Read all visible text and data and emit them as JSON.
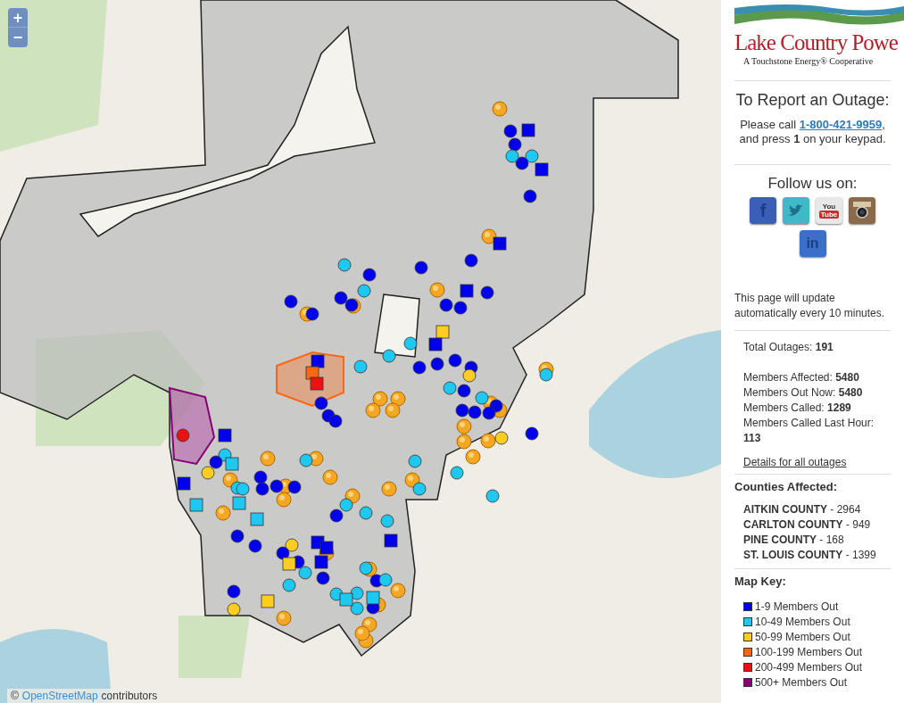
{
  "map": {
    "zoom_in": "+",
    "zoom_out": "−",
    "attribution": {
      "prefix": "©",
      "link": "OpenStreetMap",
      "suffix": "contributors"
    }
  },
  "sidebar": {
    "logo": {
      "name": "Lake Country Powe",
      "tagline": "A Touchstone Energy® Cooperative"
    },
    "report": {
      "title": "To Report an Outage:",
      "before": "Please call",
      "phone": "1-800-421-9959",
      "after": ", and press **1** on your keypad."
    },
    "follow": {
      "title": "Follow us on:",
      "socials": [
        {
          "kind": "facebook",
          "glyph": "f"
        },
        {
          "kind": "twitter"
        },
        {
          "kind": "youtube",
          "glyph": "You",
          "glyph2": "Tube"
        },
        {
          "kind": "instagram"
        },
        {
          "kind": "linkedin",
          "glyph": "in"
        }
      ]
    },
    "update_note": "This page will update automatically every 10 minutes.",
    "stats": {
      "total": {
        "label": "Total Outages:",
        "value": "191"
      },
      "items": [
        {
          "label": "Members Affected:",
          "value": "5480"
        },
        {
          "label": "Members Out Now:",
          "value": "5480"
        },
        {
          "label": "Members Called:",
          "value": "1289"
        },
        {
          "label": "Members Called Last Hour:",
          "value": "113"
        }
      ],
      "details_link": "Details for all outages"
    },
    "counties": {
      "title": "Counties Affected:",
      "items": [
        {
          "name": "AITKIN COUNTY",
          "count": "- 2964"
        },
        {
          "name": "CARLTON COUNTY",
          "count": "- 949"
        },
        {
          "name": "PINE COUNTY",
          "count": "- 168"
        },
        {
          "name": "ST. LOUIS COUNTY",
          "count": "- 1399"
        }
      ]
    },
    "map_key": {
      "title": "Map Key:",
      "items": [
        {
          "label": "1-9 Members Out",
          "color": "#0000ee"
        },
        {
          "label": "10-49 Members Out",
          "color": "#1ec8f0"
        },
        {
          "label": "50-99 Members Out",
          "color": "#ffcc22"
        },
        {
          "label": "100-199 Members Out",
          "color": "#ff6611"
        },
        {
          "label": "200-499 Members Out",
          "color": "#ee1111"
        },
        {
          "label": "500+ Members Out",
          "color": "#880077"
        }
      ]
    }
  }
}
